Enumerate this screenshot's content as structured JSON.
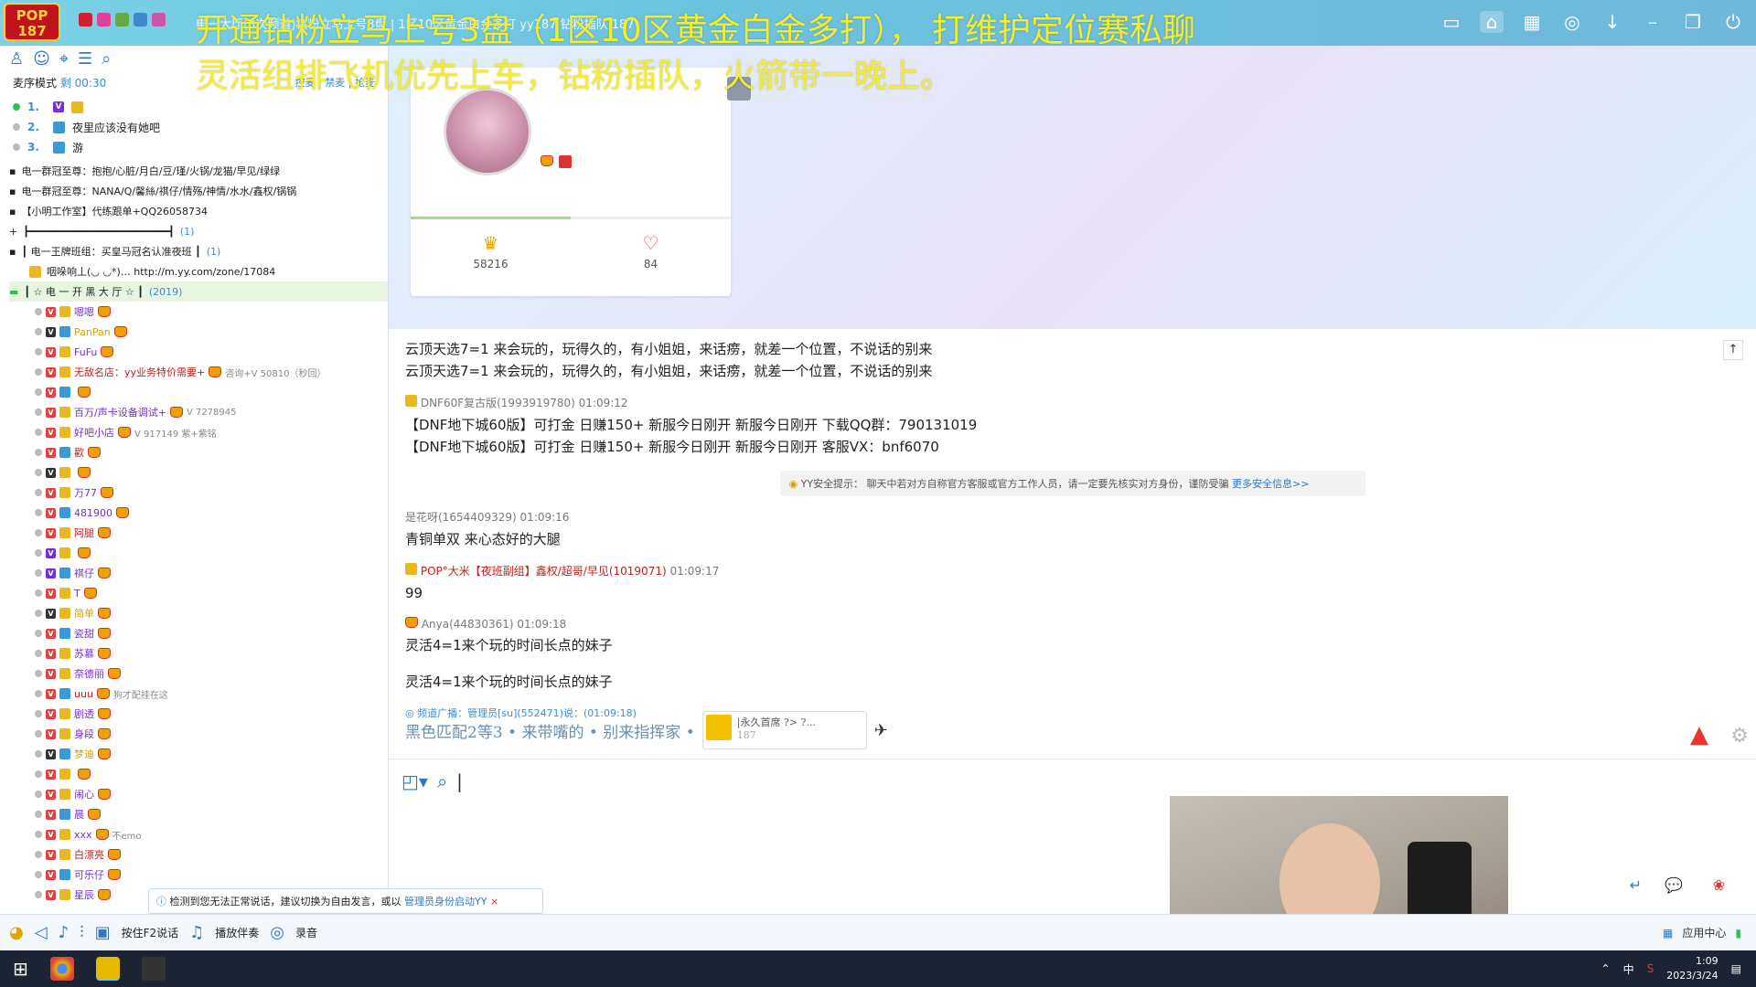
{
  "topbar": {
    "logo_text": "POP 187",
    "channel_title": "电一大厅(3次频道)钻粉立马上号3盘 | 1区10区黄金白金多打 yy187 钻粉插队 187",
    "banner_line1": "开通钻粉立马上号3盘（1区10区黄金白金多打），  打维护定位赛私聊",
    "banner_line2": "灵活组排飞机优先上车，钻粉插队，火箭带一晚上。",
    "icons": [
      "video-icon",
      "home-icon",
      "grid-icon",
      "gamepad-icon",
      "download-icon",
      "minimize-icon",
      "restore-icon",
      "power-icon"
    ]
  },
  "sidebar": {
    "mode_label": "麦序模式",
    "timer": "剩 00:30",
    "actions": [
      "控麦",
      "禁麦",
      "抢麦"
    ],
    "queue": [
      {
        "num": "1.",
        "name": ""
      },
      {
        "num": "2.",
        "name": "夜里应该没有她吧"
      },
      {
        "num": "3.",
        "name": "游"
      }
    ],
    "tree": [
      {
        "label": "电一群冠至尊：抱抱/心脏/月白/豆/瑾/火锅/龙猫/早见/绿绿",
        "count": ""
      },
      {
        "label": "电一群冠至尊：NANA/Q/馨絲/祺仔/情殇/神情/水水/鑫权/锅锅",
        "count": ""
      },
      {
        "label": "【小明工作室】代练跟单+QQ26058734",
        "count": ""
      },
      {
        "label": "┣━━━━━━━━━━━━━━━━━━━━━━━┫",
        "count": "(1)"
      },
      {
        "label": "┃   电一王牌班组：买皇马冠名认准夜班   ┃",
        "count": "(1)"
      },
      {
        "label": "咽哚响丄(◡ ◡*)…  http://m.yy.com/zone/17084",
        "count": ""
      },
      {
        "label": "┃  ☆   电 一 开 黑 大 厅   ☆      ┃",
        "count": "(2019)"
      }
    ],
    "members": [
      {
        "name": "嗯嗯",
        "extra": ""
      },
      {
        "name": "PanPan",
        "extra": ""
      },
      {
        "name": "FuFu",
        "extra": ""
      },
      {
        "name": "无敌名店：yy业务特价需要+",
        "extra": "咨询+V 50810（秒回）"
      },
      {
        "name": "",
        "extra": ""
      },
      {
        "name": "百万/声卡设备调试+",
        "extra": "V 7278945"
      },
      {
        "name": "好吧小店",
        "extra": "V 917149 紫+紫铭"
      },
      {
        "name": "歡",
        "extra": ""
      },
      {
        "name": "",
        "extra": ""
      },
      {
        "name": "万77",
        "extra": ""
      },
      {
        "name": "481900",
        "extra": ""
      },
      {
        "name": "阿腿",
        "extra": ""
      },
      {
        "name": "",
        "extra": ""
      },
      {
        "name": "祺仔",
        "extra": ""
      },
      {
        "name": "T",
        "extra": ""
      },
      {
        "name": "简单",
        "extra": ""
      },
      {
        "name": "瓷甜",
        "extra": ""
      },
      {
        "name": "苏慕",
        "extra": ""
      },
      {
        "name": "奈德丽",
        "extra": ""
      },
      {
        "name": "uuu",
        "extra": "狗才配挂在这"
      },
      {
        "name": "剧透",
        "extra": ""
      },
      {
        "name": "身段",
        "extra": ""
      },
      {
        "name": "梦迪",
        "extra": ""
      },
      {
        "name": "",
        "extra": ""
      },
      {
        "name": "闹心",
        "extra": ""
      },
      {
        "name": "晨",
        "extra": ""
      },
      {
        "name": "xxx",
        "extra": "不emo"
      },
      {
        "name": "白漂亮",
        "extra": ""
      },
      {
        "name": "可乐仔",
        "extra": ""
      },
      {
        "name": "星辰",
        "extra": ""
      }
    ],
    "notice_text": "检测到您无法正常说话，建议切换为自由发言，或以",
    "notice_link": "管理员身份启动YY"
  },
  "profile": {
    "stat_left": "58216",
    "stat_right": "84",
    "progress": 0.5
  },
  "chat": {
    "lines_top": [
      "云顶天选7=1 来会玩的，玩得久的，有小姐姐，来话痨，就差一个位置，不说话的别来",
      "云顶天选7=1 来会玩的，玩得久的，有小姐姐，来话痨，就差一个位置，不说话的别来"
    ],
    "messages": [
      {
        "sender": "DNF60F复古版(1993919780)",
        "time": "01:09:12",
        "lines": [
          "【DNF地下城60版】可打金   日赚150+ 新服今日刚开  新服今日刚开  下载QQ群：790131019",
          "【DNF地下城60版】可打金   日赚150+ 新服今日刚开  新服今日刚开  客服VX：bnf6070"
        ]
      },
      {
        "sender": "是花呀(1654409329)",
        "time": "01:09:16",
        "lines": [
          "青铜单双 来心态好的大腿"
        ]
      },
      {
        "sender": "POP°大米【夜班副组】鑫权/超哥/早见(1019071)",
        "time": "01:09:17",
        "lines": [
          "99"
        ]
      },
      {
        "sender": "Anya(44830361)",
        "time": "01:09:18",
        "lines": [
          "灵活4=1来个玩的时间长点的妹子",
          "灵活4=1来个玩的时间长点的妹子"
        ]
      }
    ],
    "safety_text": "YY安全提示：  聊天中若对方自称官方客服或官方工作人员，请一定要先核实对方身份，谨防受骗",
    "safety_link": "更多安全信息>>",
    "broadcast": "频道广播：管理员[su](552471)说：(01:09:18)",
    "ad_text": "黑色匹配2等3 • 来带嘴的 • 别来指挥家 •",
    "ad_box_text": "|永久首席 ?> ?...",
    "ad_box_sub": "187"
  },
  "bottombar": {
    "f2_label": "按住F2说话",
    "music_label": "播放伴奏",
    "record_label": "录音",
    "app_center": "应用中心"
  },
  "taskbar": {
    "time": "1:09",
    "date": "2023/3/24",
    "ime": "中"
  }
}
